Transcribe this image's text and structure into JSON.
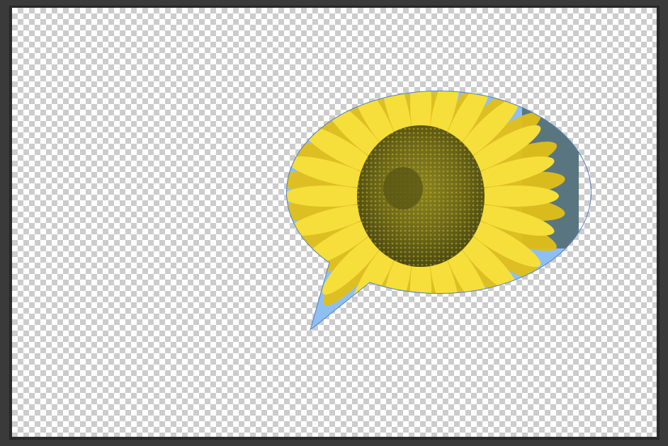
{
  "workspace": {
    "background_color": "#3a3a3a",
    "canvas_frame_color": "#2b2b2b"
  },
  "canvas": {
    "transparency_pattern": "checkerboard",
    "checker_light": "#ffffff",
    "checker_dark": "#cccccc"
  },
  "layer": {
    "shape": "speech-bubble-icon",
    "fill_image": "sunflower-photo",
    "sky_color": "#8fbff2",
    "petal_color": "#f6df3a",
    "petal_dark_color": "#e2bf17",
    "disk_color": "#6f6a1a",
    "disk_dark_color": "#4c4a12",
    "outline_color": "#4f7fc0"
  }
}
